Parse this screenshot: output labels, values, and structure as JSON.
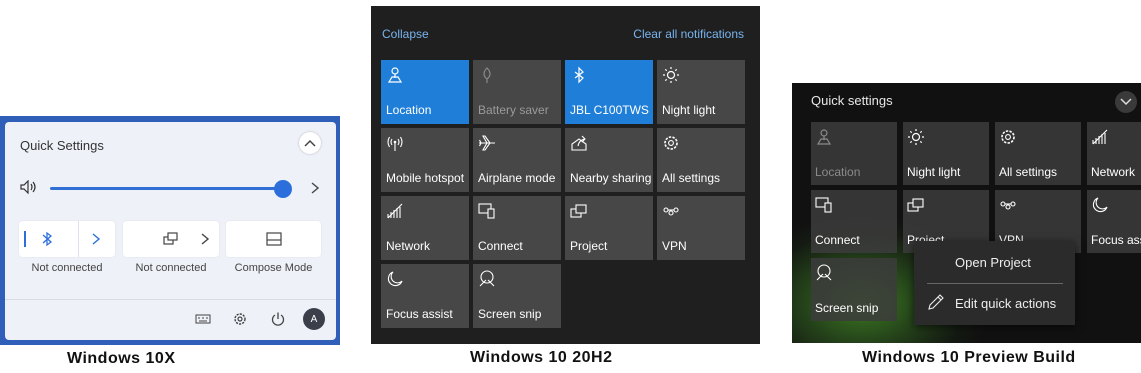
{
  "win10x": {
    "title": "Quick Settings",
    "volume_percent": 100,
    "tiles": [
      {
        "label": "Not connected"
      },
      {
        "label": "Not connected"
      },
      {
        "label": "Compose Mode"
      }
    ],
    "bottom_icons": [
      "keyboard-icon",
      "gear-icon",
      "power-icon"
    ],
    "avatar_letter": "A",
    "caption": "Windows 10X"
  },
  "win20h2": {
    "collapse": "Collapse",
    "clear_all": "Clear all notifications",
    "tiles": [
      {
        "label": "Location",
        "icon": "location-icon",
        "state": "on"
      },
      {
        "label": "Battery saver",
        "icon": "battery-saver-icon",
        "state": "disabled"
      },
      {
        "label": "JBL C100TWS",
        "icon": "bluetooth-icon",
        "state": "on"
      },
      {
        "label": "Night light",
        "icon": "night-light-icon",
        "state": "off"
      },
      {
        "label": "Mobile hotspot",
        "icon": "hotspot-icon",
        "state": "off"
      },
      {
        "label": "Airplane mode",
        "icon": "airplane-icon",
        "state": "off"
      },
      {
        "label": "Nearby sharing",
        "icon": "share-icon",
        "state": "off"
      },
      {
        "label": "All settings",
        "icon": "gear-icon",
        "state": "off"
      },
      {
        "label": "Network",
        "icon": "network-icon",
        "state": "off"
      },
      {
        "label": "Connect",
        "icon": "connect-icon",
        "state": "off"
      },
      {
        "label": "Project",
        "icon": "project-icon",
        "state": "off"
      },
      {
        "label": "VPN",
        "icon": "vpn-icon",
        "state": "off"
      },
      {
        "label": "Focus assist",
        "icon": "moon-icon",
        "state": "off"
      },
      {
        "label": "Screen snip",
        "icon": "screen-snip-icon",
        "state": "off"
      }
    ],
    "caption": "Windows 10 20H2"
  },
  "preview": {
    "title": "Quick settings",
    "tiles": [
      {
        "label": "Location",
        "icon": "location-icon",
        "state": "disabled"
      },
      {
        "label": "Night light",
        "icon": "night-light-icon",
        "state": "off"
      },
      {
        "label": "All settings",
        "icon": "gear-icon",
        "state": "off"
      },
      {
        "label": "Network",
        "icon": "network-icon",
        "state": "off"
      },
      {
        "label": "Connect",
        "icon": "connect-icon",
        "state": "off"
      },
      {
        "label": "Project",
        "icon": "project-icon",
        "state": "off"
      },
      {
        "label": "VPN",
        "icon": "vpn-icon",
        "state": "off"
      },
      {
        "label": "Focus assist",
        "icon": "moon-icon",
        "state": "off"
      },
      {
        "label": "Screen snip",
        "icon": "screen-snip-icon",
        "state": "off"
      }
    ],
    "context_menu": {
      "open_project": "Open Project",
      "edit_quick_actions": "Edit quick actions"
    },
    "caption": "Windows 10 Preview Build"
  },
  "colors": {
    "accent_blue": "#1f7fd8",
    "tile_gray": "#474747",
    "link_blue": "#78b4f0",
    "win10x_frame": "#2f5fb8"
  }
}
